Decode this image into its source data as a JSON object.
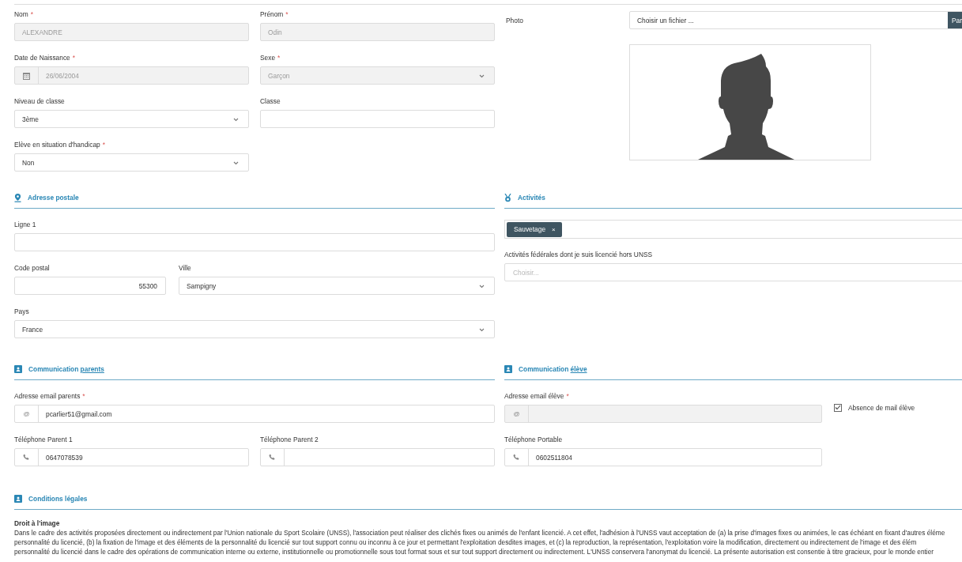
{
  "identity": {
    "rows": [
      [
        {
          "label": "Nom",
          "required_mark": "*",
          "kind": "text",
          "value": "ALEXANDRE",
          "disabled": true
        },
        {
          "label": "Prénom",
          "required_mark": "*",
          "kind": "text",
          "value": "Odin",
          "disabled": true
        }
      ],
      [
        {
          "label": "Date de Naissance",
          "required_mark": "*",
          "kind": "date",
          "value": "26/06/2004",
          "disabled": true
        },
        {
          "label": "Sexe",
          "required_mark": "*",
          "kind": "select",
          "value": "Garçon",
          "disabled": true
        }
      ],
      [
        {
          "label": "Niveau de classe",
          "kind": "select",
          "value": "3ème",
          "disabled": false
        },
        {
          "label": "Classe",
          "kind": "text",
          "disabled": false
        }
      ],
      [
        {
          "label": "Elève en situation d'handicap",
          "required_mark": "*",
          "kind": "select",
          "value": "Non",
          "disabled": false
        }
      ]
    ]
  },
  "photo": {
    "label": "Photo",
    "file_placeholder": "Choisir un fichier ...",
    "browse_button": "Par"
  },
  "address": {
    "title": "Adresse postale",
    "rows": [
      [
        {
          "label": "Ligne 1",
          "kind": "text",
          "disabled": false
        }
      ],
      [
        {
          "label": "Code postal",
          "kind": "number",
          "value": "55300",
          "disabled": false
        },
        {
          "label": "Ville",
          "kind": "select",
          "value": "Sampigny",
          "disabled": false
        }
      ],
      [
        {
          "label": "Pays",
          "kind": "select",
          "value": "France",
          "disabled": false
        }
      ]
    ]
  },
  "activities": {
    "title": "Activités",
    "tags": [
      {
        "label": "Sauvetage",
        "remove": "×"
      }
    ],
    "federal_label": "Activités fédérales dont je suis licencié hors UNSS",
    "federal_placeholder": "Choisir..."
  },
  "comm_parents": {
    "title": "Communication",
    "title_link": "parents",
    "rows": [
      [
        {
          "label": "Adresse email parents",
          "required_mark": "*",
          "kind": "email",
          "prefix": "@",
          "value": "pcarlier51@gmail.com",
          "disabled": false
        }
      ],
      [
        {
          "label": "Téléphone Parent 1",
          "kind": "phone",
          "value": "0647078539",
          "disabled": false
        },
        {
          "label": "Téléphone Parent 2",
          "kind": "phone",
          "disabled": false
        }
      ]
    ]
  },
  "comm_student": {
    "title": "Communication",
    "title_link": "élève",
    "rows": [
      [
        {
          "label": "Adresse email élève",
          "required_mark": "*",
          "kind": "email",
          "prefix": "@",
          "disabled": true
        }
      ],
      [
        {
          "label": "Téléphone Portable",
          "kind": "phone",
          "value": "0602511804",
          "disabled": false
        }
      ]
    ],
    "no_email": {
      "label": "Absence de mail élève",
      "checked": true
    }
  },
  "legal": {
    "title": "Conditions légales",
    "subtitle": "Droit à l'image",
    "lines": [
      "Dans le cadre des activités proposées directement ou indirectement par l'Union nationale du Sport Scolaire (UNSS), l'association peut réaliser des clichés fixes ou animés de l'enfant licencié. A cet effet, l'adhésion à l'UNSS vaut acceptation de (a) la prise d'images fixes ou animées, le cas échéant en fixant d'autres éléme",
      "personnalité du licencié, (b) la fixation de l'image et des éléments de la personnalité du licencié sur tout support connu ou inconnu à ce jour et permettant l'exploitation desdites images, et (c) la reproduction, la représentation, l'exploitation voire la modification, directement ou indirectement de l'image et des élém",
      "personnalité du licencié dans le cadre des opérations de communication interne ou externe, institutionnelle ou promotionnelle sous tout format sous et sur tout support directement ou indirectement. L'UNSS conservera l'anonymat du licencié. La présente autorisation est consentie à titre gracieux, pour le monde entier"
    ]
  }
}
